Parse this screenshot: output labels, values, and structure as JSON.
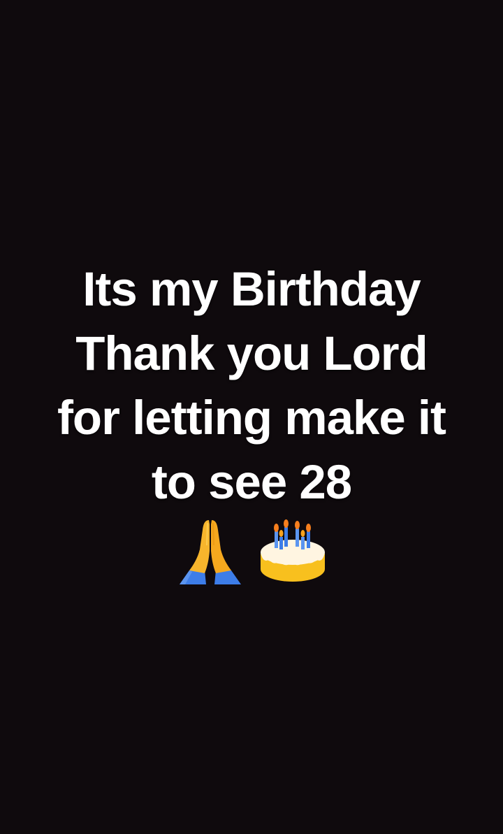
{
  "status": {
    "lines": [
      "Its my Birthday",
      "Thank you Lord",
      "for letting make it",
      "to see 28"
    ]
  },
  "emojis": [
    "folded-hands-icon",
    "birthday-cake-icon"
  ],
  "colors": {
    "background": "#0f0a0d",
    "text": "#ffffff"
  }
}
